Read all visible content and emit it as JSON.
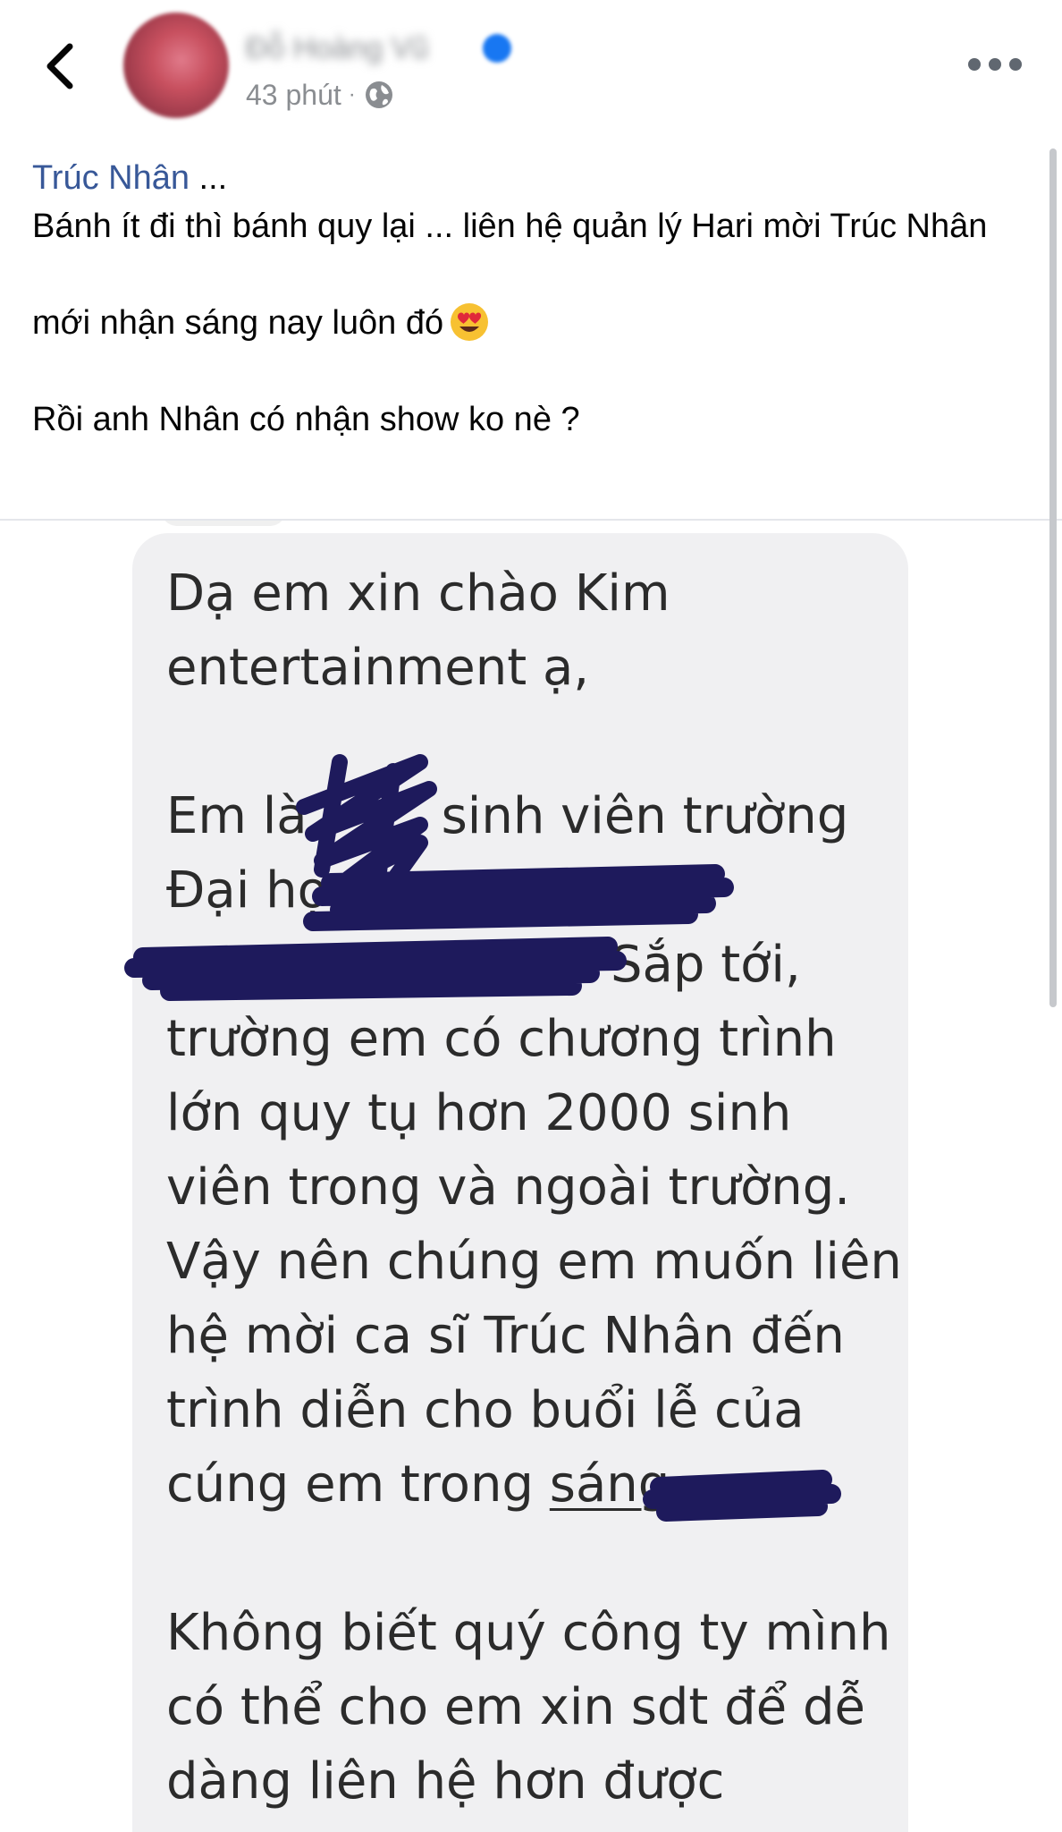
{
  "header": {
    "poster_name": "Đỗ Hoàng Vũ",
    "time": "43 phút",
    "separator": "·"
  },
  "post": {
    "mention": "Trúc Nhân",
    "mention_suffix": " ...",
    "line1": "Bánh ít đi thì bánh quy lại ... liên hệ quản lý Hari mời Trúc Nhân",
    "line2": "mới nhận sáng nay luôn đó",
    "line2_emoji": "heart-eyes-emoji",
    "line3": "Rồi anh Nhân có nhận show ko nè ?"
  },
  "message": {
    "l1": "Dạ em xin chào Kim",
    "l2": "entertainment ạ,",
    "l3a": "Em là",
    "l3b": "sinh viên trường",
    "l4": "Đại họ",
    "l5": "Sắp tới,",
    "l6": "trường em có chương trình",
    "l7": "lớn quy tụ hơn 2000 sinh",
    "l8": "viên trong và ngoài trường.",
    "l9": "Vậy nên chúng em muốn liên",
    "l10": "hệ mời ca sĩ Trúc Nhân đến",
    "l11": "trình diễn cho buổi lễ của",
    "l12a": "cúng em trong",
    "l12b": "sáng",
    "l13": "Không biết quý công ty mình",
    "l14": "có thể cho em xin sdt để dễ",
    "l15": "dàng liên hệ hơn được"
  },
  "colors": {
    "link": "#385898",
    "meta": "#8a8d91",
    "bubble": "#f0f0f2",
    "redaction_ink": "#1e1a5c"
  },
  "icons": [
    "back-arrow-icon",
    "globe-icon",
    "verified-badge-icon",
    "more-options-icon"
  ]
}
